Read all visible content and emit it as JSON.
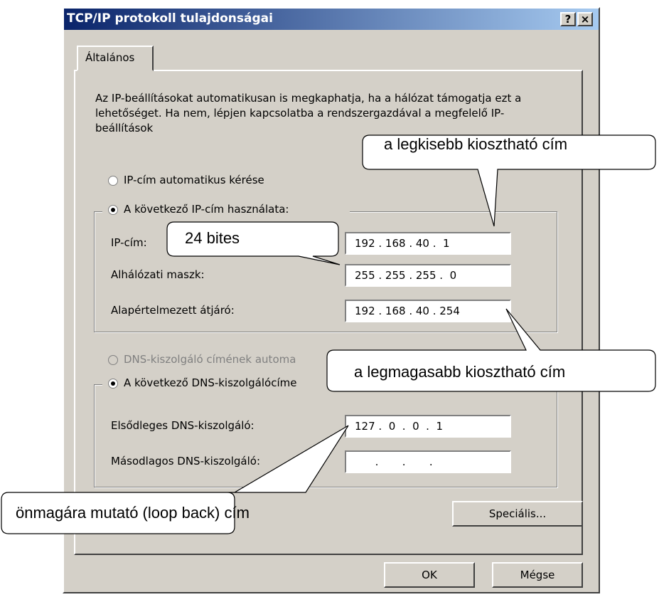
{
  "window": {
    "title": "TCP/IP protokoll tulajdonságai",
    "help_label": "?",
    "close_label": "×"
  },
  "tab": {
    "label": "Általános"
  },
  "description": "Az IP-beállításokat automatikusan is megkaphatja, ha a hálózat támogatja ezt a lehetőséget. Ha nem, lépjen kapcsolatba a rendszergazdával a megfelelő IP-beállítások",
  "ip_options": {
    "auto_label": "IP-cím automatikus kérése",
    "manual_label": "A következő IP-cím használata:"
  },
  "ip_fields": {
    "ip_label": "IP-cím:",
    "ip_value": "192 . 168 . 40 .  1",
    "mask_label": "Alhálózati maszk:",
    "mask_value": "255 . 255 . 255 .  0",
    "gateway_label": "Alapértelmezett átjáró:",
    "gateway_value": "192 . 168 . 40 . 254"
  },
  "dns_options": {
    "auto_label": "DNS-kiszolgáló címének automa",
    "manual_label": "A következő DNS-kiszolgálócíme"
  },
  "dns_fields": {
    "primary_label": "Elsődleges DNS-kiszolgáló:",
    "primary_value": "127 .  0  .  0  .  1",
    "secondary_label": "Másodlagos DNS-kiszolgáló:",
    "secondary_value": "      .       .       ."
  },
  "buttons": {
    "advanced": "Speciális...",
    "ok": "OK",
    "cancel": "Mégse"
  },
  "callouts": {
    "lowest": "a legkisebb kiosztható cím",
    "bits": "24 bites",
    "highest": "a legmagasabb kiosztható cím",
    "loopback": "önmagára mutató (loop back) cím"
  }
}
